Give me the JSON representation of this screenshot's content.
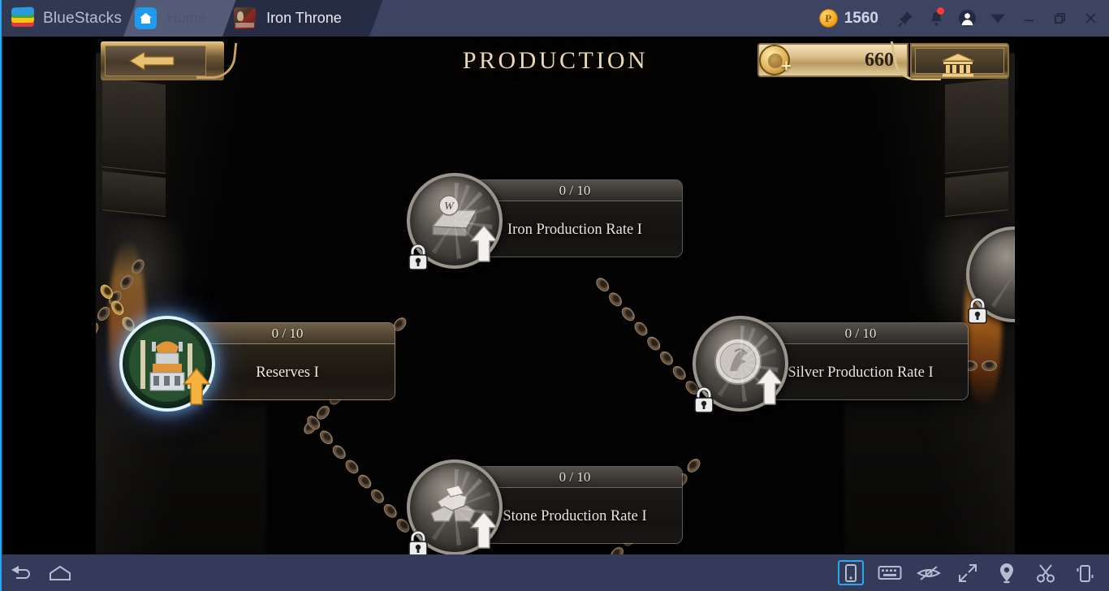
{
  "emulator": {
    "brand": "BlueStacks",
    "tabs": [
      {
        "label": "Home",
        "icon": "home-icon",
        "active": false
      },
      {
        "label": "Iron Throne",
        "icon": "game-avatar-icon",
        "active": true
      }
    ],
    "points": "1560",
    "point_icon": "bluestacks-points-coin-icon",
    "controls": [
      "pin-icon",
      "notifications-bell-icon",
      "user-account-icon",
      "chevron-down-icon",
      "minimize-button",
      "restore-button",
      "close-button"
    ],
    "bottom_left": [
      "back-nav-icon",
      "home-nav-icon"
    ],
    "bottom_right": [
      "rotate-device-icon",
      "keyboard-controls-icon",
      "eye-hidden-icon",
      "fullscreen-icon",
      "location-pin-icon",
      "screenshot-scissors-icon",
      "shake-device-icon"
    ]
  },
  "game": {
    "title": "PRODUCTION",
    "back_button": "back-arrow-button",
    "currency": {
      "value": "660",
      "plus": "+",
      "coin_icon": "gold-coin-icon",
      "bank_icon": "bank-building-icon"
    },
    "nodes": [
      {
        "id": "iron-production-rate-1",
        "name": "Iron Production Rate I",
        "progress": "0 / 10",
        "locked": true,
        "icon": "iron-ingot-icon"
      },
      {
        "id": "reserves-1",
        "name": "Reserves I",
        "progress": "0 / 10",
        "locked": false,
        "icon": "castle-keep-icon"
      },
      {
        "id": "silver-production-rate-1",
        "name": "Silver Production Rate I",
        "progress": "0 / 10",
        "locked": true,
        "icon": "silver-coin-icon"
      },
      {
        "id": "stone-production-rate-1",
        "name": "Stone Production Rate I",
        "progress": "0 / 10",
        "locked": true,
        "icon": "stone-rocks-icon"
      }
    ]
  },
  "colors": {
    "accent": "#29a8f0",
    "chrome": "#3c4462",
    "gold": "#d9b96a",
    "title_text": "#e8d9bb",
    "active_glow": "#7cc8ff"
  }
}
